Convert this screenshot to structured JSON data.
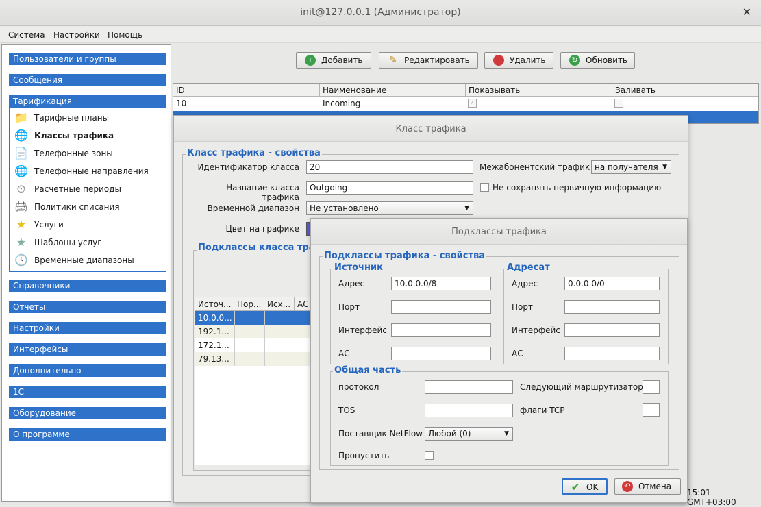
{
  "window": {
    "title": "init@127.0.0.1 (Администратор)",
    "close_glyph": "✕"
  },
  "menu": [
    "Система",
    "Настройки",
    "Помощь"
  ],
  "nav": {
    "sections": [
      "Пользователи и группы",
      "Сообщения",
      "Тарификация",
      "Справочники",
      "Отчеты",
      "Настройки",
      "Интерфейсы",
      "Дополнительно",
      "1С",
      "Оборудование",
      "О программе"
    ],
    "items": [
      {
        "label": "Тарифные планы",
        "icon": "tariff-plan-icon",
        "glyph": "📁"
      },
      {
        "label": "Классы трафика",
        "icon": "traffic-class-icon",
        "glyph": "🌐"
      },
      {
        "label": "Телефонные зоны",
        "icon": "phone-zone-icon",
        "glyph": "📄"
      },
      {
        "label": "Телефонные направления",
        "icon": "phone-direction-icon",
        "glyph": "🌐"
      },
      {
        "label": "Расчетные периоды",
        "icon": "billing-period-icon",
        "glyph": "⏲"
      },
      {
        "label": "Политики списания",
        "icon": "write-off-policy-icon",
        "glyph": "🖨"
      },
      {
        "label": "Услуги",
        "icon": "service-star-icon",
        "glyph": "★"
      },
      {
        "label": "Шаблоны услуг",
        "icon": "service-template-icon",
        "glyph": "★"
      },
      {
        "label": "Временные диапазоны",
        "icon": "time-range-icon",
        "glyph": "🕓"
      }
    ]
  },
  "toolbar": {
    "add": "Добавить",
    "edit": "Редактировать",
    "delete": "Удалить",
    "refresh": "Обновить",
    "add_glyph": "+",
    "edit_glyph": "✎",
    "delete_glyph": "−",
    "refresh_glyph": "↻"
  },
  "main_table": {
    "columns": [
      "ID",
      "Наименование",
      "Показывать",
      "Заливать"
    ],
    "rows": [
      {
        "id": "10",
        "name": "Incoming",
        "show": true,
        "fill": false
      }
    ]
  },
  "traffic_class_dialog": {
    "title": "Класс трафика",
    "legend": "Класс трафика - свойства",
    "id_label": "Идентификатор класса",
    "id_value": "20",
    "name_label": "Название класса трафика",
    "name_value": "Outgoing",
    "time_label": "Временной диапазон",
    "time_value": "Не установлено",
    "color_label": "Цвет на графике",
    "inter_label": "Межабонентский трафик",
    "inter_value": "на получателя",
    "nosave_label": "Не сохранять первичную информацию",
    "subclasses_legend": "Подклассы класса трафика",
    "sub_columns": [
      "Источ...",
      "Пор...",
      "Исх...",
      "АС"
    ],
    "sub_rows": [
      "10.0.0...",
      "192.1...",
      "172.1...",
      "79.13..."
    ],
    "selected_color": "#2f72c9"
  },
  "subclass_dialog": {
    "title": "Подклассы трафика",
    "legend": "Подклассы трафика - свойства",
    "source_legend": "Источник",
    "dest_legend": "Адресат",
    "address_label": "Адрес",
    "port_label": "Порт",
    "interface_label": "Интерфейс",
    "as_label": "АС",
    "source_address": "10.0.0.0/8",
    "dest_address": "0.0.0.0/0",
    "common_legend": "Общая часть",
    "protocol_label": "протокол",
    "tos_label": "TOS",
    "netflow_label": "Поставщик NetFlow",
    "netflow_value": "Любой (0)",
    "skip_label": "Пропустить",
    "next_router_label": "Следующий маршрутизатор",
    "tcp_flags_label": "флаги TCP",
    "ok": "OK",
    "cancel": "Отмена",
    "ok_glyph": "✔",
    "cancel_glyph": "↶"
  },
  "status": {
    "time": "15:01 GMT+03:00"
  },
  "colors": {
    "accent": "#2f72c9",
    "selection": "#2f72c9"
  }
}
